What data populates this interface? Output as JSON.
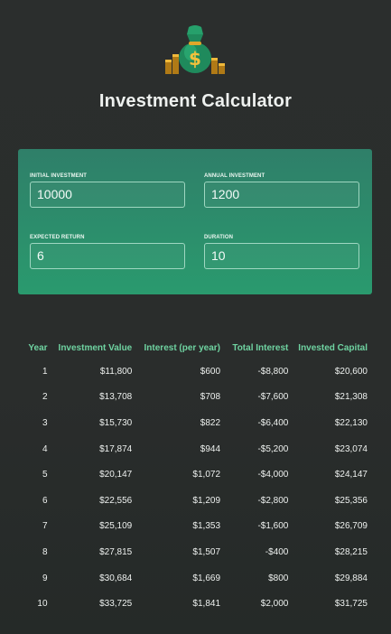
{
  "header": {
    "title": "Investment Calculator",
    "logo_icon": "money-bag-icon"
  },
  "form": {
    "initial_investment": {
      "label": "Initial Investment",
      "value": "10000"
    },
    "annual_investment": {
      "label": "Annual Investment",
      "value": "1200"
    },
    "expected_return": {
      "label": "Expected Return",
      "value": "6"
    },
    "duration": {
      "label": "Duration",
      "value": "10"
    }
  },
  "table": {
    "headers": [
      "Year",
      "Investment Value",
      "Interest (per year)",
      "Total Interest",
      "Invested Capital"
    ],
    "rows": [
      [
        "1",
        "$11,800",
        "$600",
        "-$8,800",
        "$20,600"
      ],
      [
        "2",
        "$13,708",
        "$708",
        "-$7,600",
        "$21,308"
      ],
      [
        "3",
        "$15,730",
        "$822",
        "-$6,400",
        "$22,130"
      ],
      [
        "4",
        "$17,874",
        "$944",
        "-$5,200",
        "$23,074"
      ],
      [
        "5",
        "$20,147",
        "$1,072",
        "-$4,000",
        "$24,147"
      ],
      [
        "6",
        "$22,556",
        "$1,209",
        "-$2,800",
        "$25,356"
      ],
      [
        "7",
        "$25,109",
        "$1,353",
        "-$1,600",
        "$26,709"
      ],
      [
        "8",
        "$27,815",
        "$1,507",
        "-$400",
        "$28,215"
      ],
      [
        "9",
        "$30,684",
        "$1,669",
        "$800",
        "$29,884"
      ],
      [
        "10",
        "$33,725",
        "$1,841",
        "$2,000",
        "$31,725"
      ]
    ]
  },
  "colors": {
    "background": "#2a2d2c",
    "form_gradient_top": "#2f7f69",
    "form_gradient_bottom": "#2a9a6e",
    "header_text": "#6fd3a1"
  }
}
